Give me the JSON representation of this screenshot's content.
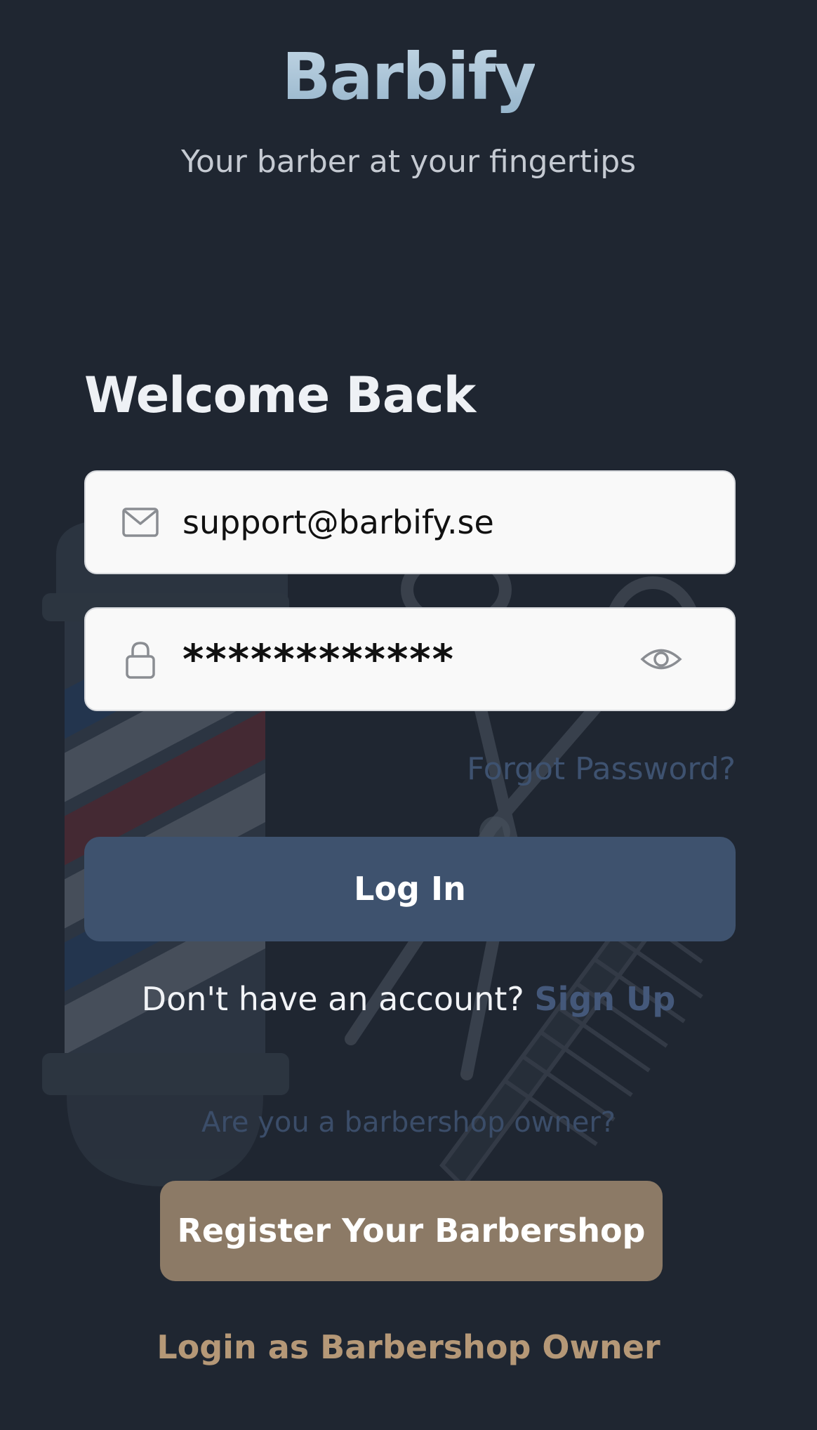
{
  "app": {
    "logo_text": "Barbify",
    "tagline": "Your barber at your fingertips"
  },
  "login": {
    "heading": "Welcome Back",
    "email_value": "support@barbify.se",
    "password_value": "************",
    "forgot_label": "Forgot Password?",
    "login_button": "Log In",
    "signup_prompt": "Don't have an account?",
    "signup_link": "Sign Up"
  },
  "owner": {
    "question": "Are you a barbershop owner?",
    "register_button": "Register Your Barbershop",
    "owner_login_link": "Login as Barbershop Owner"
  },
  "icons": {
    "email": "mail-icon",
    "password": "lock-icon",
    "toggle": "eye-icon",
    "logo_mark": "scissors-icon"
  },
  "colors": {
    "background": "#1f2631",
    "primary_button": "#3e526e",
    "accent_tan": "#8c7a66",
    "owner_link": "#b59877",
    "muted_link": "#44587a"
  }
}
